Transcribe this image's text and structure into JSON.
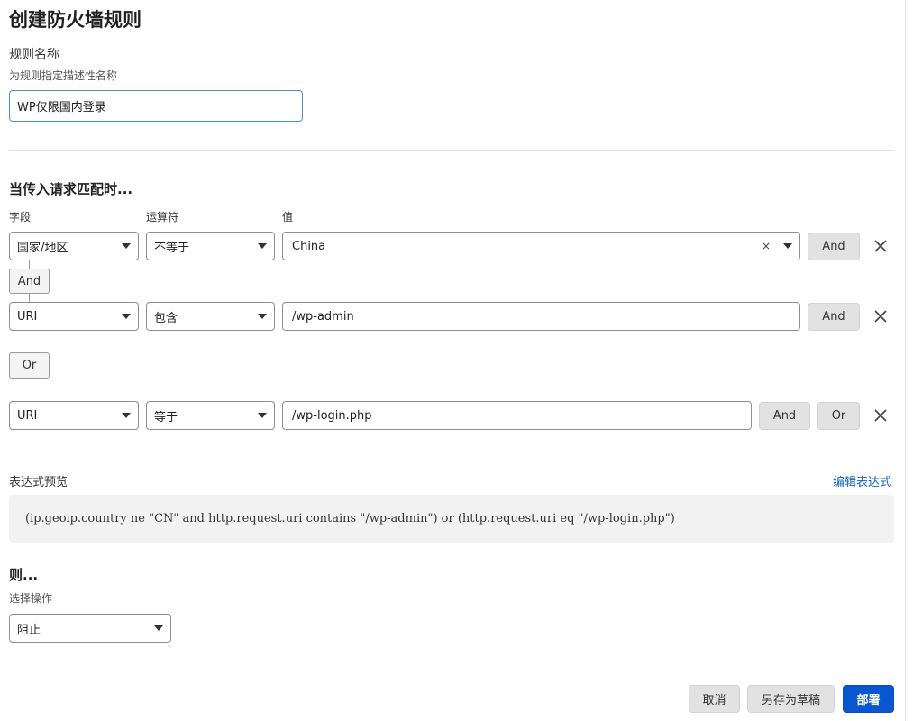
{
  "page": {
    "title": "创建防火墙规则"
  },
  "rule_name": {
    "label": "规则名称",
    "hint": "为规则指定描述性名称",
    "value": "WP仅限国内登录"
  },
  "match": {
    "heading": "当传入请求匹配时...",
    "columns": {
      "field": "字段",
      "operator": "运算符",
      "value": "值"
    },
    "rows": [
      {
        "field": "国家/地区",
        "operator": "不等于",
        "value": "China",
        "clear_symbol": "×",
        "and_label": "And"
      },
      {
        "field": "URI",
        "operator": "包含",
        "value": "/wp-admin",
        "and_label": "And"
      },
      {
        "field": "URI",
        "operator": "等于",
        "value": "/wp-login.php",
        "and_label": "And",
        "or_label": "Or"
      }
    ],
    "and_connector_label": "And",
    "or_connector_label": "Or"
  },
  "expression": {
    "label": "表达式预览",
    "edit_link": "编辑表达式",
    "text": "(ip.geoip.country ne \"CN\" and http.request.uri contains \"/wp-admin\") or (http.request.uri eq \"/wp-login.php\")"
  },
  "then": {
    "heading": "则...",
    "label": "选择操作",
    "action": "阻止"
  },
  "footer": {
    "cancel": "取消",
    "save_draft": "另存为草稿",
    "deploy": "部署"
  },
  "colors": {
    "primary": "#0a56d0",
    "link": "#1565c0",
    "preview_bg": "#f2f2f2"
  }
}
